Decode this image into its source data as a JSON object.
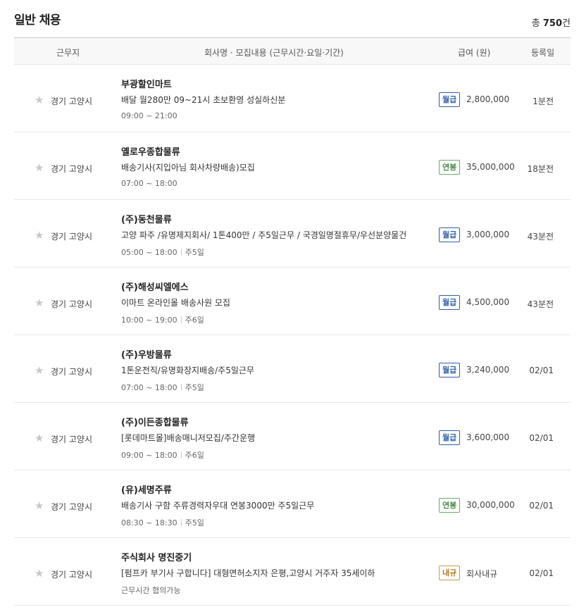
{
  "section_title": "일반 채용",
  "total": {
    "prefix": "총 ",
    "count": "750",
    "suffix": "건"
  },
  "headers": {
    "location": "근무지",
    "info": "회사명 · 모집내용 (근무시간·요일·기간)",
    "pay": "급여 (원)",
    "date": "등록일"
  },
  "rows": [
    {
      "location": "경기 고양시",
      "company": "부광할인마트",
      "title": "배달 월280만 09~21시 초보환영 성실하신분",
      "hours": "09:00 ~ 21:00",
      "days": "",
      "pay_type": "월급",
      "pay_class": "b-month",
      "pay": "2,800,000",
      "date": "1분전"
    },
    {
      "location": "경기 고양시",
      "company": "옐로우종합물류",
      "title": "배송기사(지입아님 회사차량배송)모집",
      "hours": "07:00 ~ 18:00",
      "days": "",
      "pay_type": "연봉",
      "pay_class": "b-year",
      "pay": "35,000,000",
      "date": "18분전"
    },
    {
      "location": "경기 고양시",
      "company": "(주)동천물류",
      "title": "고양 파주 /유명제지회사/ 1톤400만 / 주5일근무 / 국경일명절휴무/우선분양물건",
      "hours": "05:00 ~ 18:00",
      "days": "주5일",
      "pay_type": "월급",
      "pay_class": "b-month",
      "pay": "3,000,000",
      "date": "43분전"
    },
    {
      "location": "경기 고양시",
      "company": "(주)해성씨엘에스",
      "title": "이마트 온라인몰 배송사원 모집",
      "hours": "10:00 ~ 19:00",
      "days": "주6일",
      "pay_type": "월급",
      "pay_class": "b-month",
      "pay": "4,500,000",
      "date": "43분전"
    },
    {
      "location": "경기 고양시",
      "company": "(주)우방물류",
      "title": "1톤운전직/유명화장지배송/주5일근무",
      "hours": "07:00 ~ 18:00",
      "days": "주5일",
      "pay_type": "월급",
      "pay_class": "b-month",
      "pay": "3,240,000",
      "date": "02/01"
    },
    {
      "location": "경기 고양시",
      "company": "(주)이든종합물류",
      "title": "[롯데마트몰]배송매니저모집/주간운행",
      "hours": "09:00 ~ 18:00",
      "days": "주6일",
      "pay_type": "월급",
      "pay_class": "b-month",
      "pay": "3,600,000",
      "date": "02/01"
    },
    {
      "location": "경기 고양시",
      "company": "(유)세명주류",
      "title": "배송기사 구함 주류경력자우대 연봉3000만 주5일근무",
      "hours": "08:30 ~ 18:30",
      "days": "주5일",
      "pay_type": "연봉",
      "pay_class": "b-year",
      "pay": "30,000,000",
      "date": "02/01"
    },
    {
      "location": "경기 고양시",
      "company": "주식회사 명진중기",
      "title": "[펌프카 부기사 구합니다] 대형면허소지자 은평,고양시 거주자 35세이하",
      "hours": "근무시간 협의가능",
      "days": "",
      "pay_type": "내규",
      "pay_class": "b-in",
      "pay": "회사내규",
      "date": "02/01"
    }
  ]
}
